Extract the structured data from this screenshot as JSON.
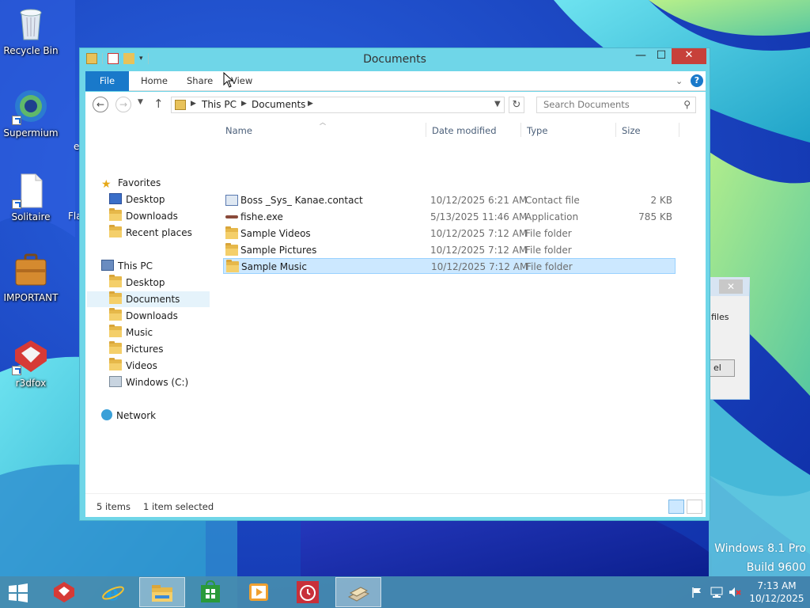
{
  "desktop": {
    "icons": [
      {
        "label": "Recycle Bin"
      },
      {
        "label": "Supermium"
      },
      {
        "label": "Solitaire"
      },
      {
        "label": "IMPORTANT"
      },
      {
        "label": "r3dfox"
      }
    ],
    "partial_labels": [
      "e",
      "Fla"
    ]
  },
  "background_dialog": {
    "text": "files",
    "button_label": "el"
  },
  "window": {
    "title": "Documents",
    "controls": {
      "minimize": "—",
      "maximize": "☐",
      "close": "✕"
    },
    "ribbon": {
      "tabs": [
        "File",
        "Home",
        "Share",
        "View"
      ],
      "help_label": "?"
    },
    "address": {
      "crumbs": [
        "This PC",
        "Documents"
      ],
      "search_placeholder": "Search Documents"
    },
    "nav": {
      "favorites_header": "Favorites",
      "favorites": [
        "Desktop",
        "Downloads",
        "Recent places"
      ],
      "thispc_header": "This PC",
      "thispc": [
        "Desktop",
        "Documents",
        "Downloads",
        "Music",
        "Pictures",
        "Videos",
        "Windows (C:)"
      ],
      "network": "Network",
      "selected": "Documents"
    },
    "columns": {
      "name": "Name",
      "date": "Date modified",
      "type": "Type",
      "size": "Size"
    },
    "files": [
      {
        "name": "Boss _Sys_ Kanae.contact",
        "date": "10/12/2025 6:21 AM",
        "type": "Contact file",
        "size": "2 KB",
        "icon": "contact-icon"
      },
      {
        "name": "fishe.exe",
        "date": "5/13/2025 11:46 AM",
        "type": "Application",
        "size": "785 KB",
        "icon": "exe-icon"
      },
      {
        "name": "Sample Videos",
        "date": "10/12/2025 7:12 AM",
        "type": "File folder",
        "size": "",
        "icon": "folder-icon"
      },
      {
        "name": "Sample Pictures",
        "date": "10/12/2025 7:12 AM",
        "type": "File folder",
        "size": "",
        "icon": "folder-icon"
      },
      {
        "name": "Sample Music",
        "date": "10/12/2025 7:12 AM",
        "type": "File folder",
        "size": "",
        "icon": "folder-icon",
        "selected": true
      }
    ],
    "status": {
      "count": "5 items",
      "selection": "1 item selected"
    }
  },
  "watermark": {
    "line1": "Windows 8.1 Pro",
    "line2": "Build 9600"
  },
  "taskbar": {
    "apps": [
      "r3dfox",
      "Internet Explorer",
      "File Explorer",
      "Store",
      "Media Player",
      "Alarms",
      "Archive tool"
    ],
    "clock_time": "7:13 AM",
    "clock_date": "10/12/2025"
  },
  "colors": {
    "window_border": "#6fd6e8",
    "accent": "#1979ca",
    "selection": "#cce8ff",
    "close": "#c7403a",
    "taskbar": "#468caf"
  }
}
